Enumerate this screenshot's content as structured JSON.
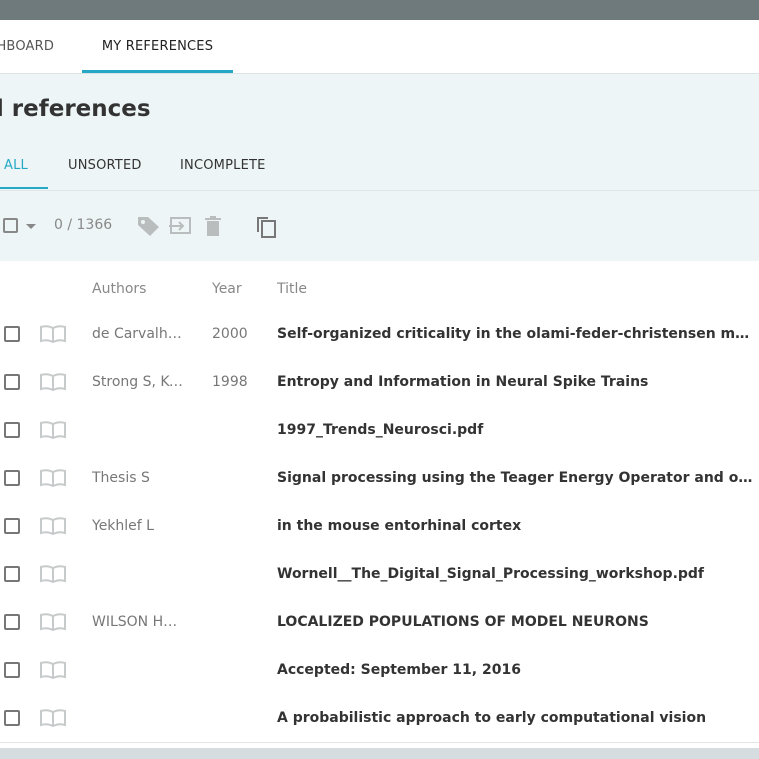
{
  "nav": {
    "tabs": [
      {
        "label": "SHBOARD"
      },
      {
        "label": "MY REFERENCES"
      }
    ]
  },
  "page": {
    "title": "ll references"
  },
  "subtabs": [
    {
      "label": "ALL"
    },
    {
      "label": "UNSORTED"
    },
    {
      "label": "INCOMPLETE"
    }
  ],
  "toolbar": {
    "count": "0 / 1366",
    "icons": [
      "tag-icon",
      "move-to-folder-icon",
      "trash-icon",
      "copy-icon"
    ]
  },
  "columns": {
    "authors": "Authors",
    "year": "Year",
    "title": "Title"
  },
  "rows": [
    {
      "authors": "de Carvalho …",
      "year": "2000",
      "title": "Self-organized criticality in the olami-feder-christensen model"
    },
    {
      "authors": "Strong S, Ko…",
      "year": "1998",
      "title": "Entropy and Information in Neural Spike Trains"
    },
    {
      "authors": "",
      "year": "",
      "title": "1997_Trends_Neurosci.pdf"
    },
    {
      "authors": "Thesis S",
      "year": "",
      "title": "Signal processing using the Teager Energy Operator and other nonlinear o…"
    },
    {
      "authors": "Yekhlef L",
      "year": "",
      "title": "in the mouse entorhinal cortex"
    },
    {
      "authors": "",
      "year": "",
      "title": "Wornell__The_Digital_Signal_Processing_workshop.pdf"
    },
    {
      "authors": "WILSON HU…",
      "year": "",
      "title": "LOCALIZED POPULATIONS OF MODEL NEURONS"
    },
    {
      "authors": "",
      "year": "",
      "title": "Accepted: September 11, 2016"
    },
    {
      "authors": "",
      "year": "",
      "title": "A probabilistic approach to early computational vision"
    }
  ],
  "colors": {
    "accent": "#25a8c6",
    "topbar": "#6e7a7b",
    "panel": "#eef5f6"
  }
}
